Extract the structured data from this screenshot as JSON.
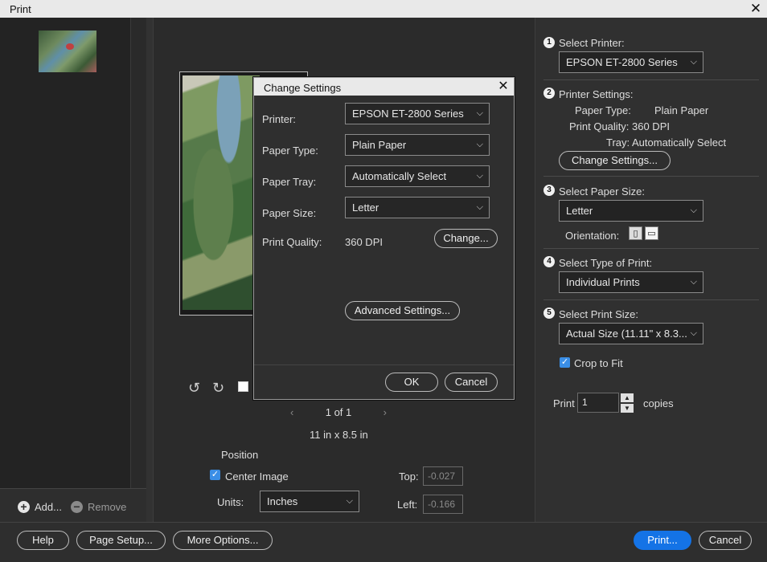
{
  "window": {
    "title": "Print",
    "close_icon": "close-icon"
  },
  "left_panel": {
    "add_label": "Add...",
    "remove_label": "Remove"
  },
  "preview": {
    "page_indicator": "1 of 1",
    "page_dimensions": "11 in x 8.5 in",
    "position_label": "Position",
    "center_image_label": "Center Image",
    "center_image_checked": true,
    "units_label": "Units:",
    "units_value": "Inches",
    "top_label": "Top:",
    "top_value": "-0.027",
    "left_label": "Left:",
    "left_value": "-0.166"
  },
  "right_panel": {
    "step1": {
      "num": "1",
      "label": "Select Printer:",
      "printer": "EPSON ET-2800 Series"
    },
    "step2": {
      "num": "2",
      "label": "Printer Settings:",
      "paper_type_label": "Paper Type:",
      "paper_type_value": "Plain Paper",
      "print_quality_label": "Print Quality:",
      "print_quality_value": "360 DPI",
      "tray_label": "Tray:",
      "tray_value": "Automatically Select",
      "change_settings_label": "Change Settings..."
    },
    "step3": {
      "num": "3",
      "label": "Select Paper Size:",
      "paper_size": "Letter",
      "orientation_label": "Orientation:"
    },
    "step4": {
      "num": "4",
      "label": "Select Type of Print:",
      "type": "Individual Prints"
    },
    "step5": {
      "num": "5",
      "label": "Select Print Size:",
      "size": "Actual Size (11.11\" x 8.3...",
      "crop_label": "Crop to Fit",
      "crop_checked": true
    },
    "copies": {
      "print_label": "Print",
      "value": "1",
      "copies_label": "copies"
    }
  },
  "bottom_bar": {
    "help_label": "Help",
    "page_setup_label": "Page Setup...",
    "more_options_label": "More Options...",
    "print_label": "Print...",
    "cancel_label": "Cancel"
  },
  "dialog": {
    "title": "Change Settings",
    "printer_label": "Printer:",
    "printer_value": "EPSON ET-2800 Series",
    "paper_type_label": "Paper Type:",
    "paper_type_value": "Plain Paper",
    "paper_tray_label": "Paper Tray:",
    "paper_tray_value": "Automatically Select",
    "paper_size_label": "Paper Size:",
    "paper_size_value": "Letter",
    "print_quality_label": "Print Quality:",
    "print_quality_value": "360 DPI",
    "change_label": "Change...",
    "advanced_label": "Advanced Settings...",
    "ok_label": "OK",
    "cancel_label": "Cancel"
  },
  "colors": {
    "accent": "#1473e6",
    "checkbox": "#3a8ee6",
    "background": "#323232"
  }
}
